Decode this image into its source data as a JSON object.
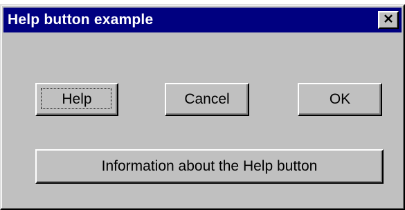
{
  "window": {
    "title": "Help button example",
    "close_icon": "close-x-icon"
  },
  "buttons": {
    "help_label": "Help",
    "cancel_label": "Cancel",
    "ok_label": "OK",
    "info_label": "Information about the Help button"
  },
  "colors": {
    "titlebar": "#000080",
    "face": "#c0c0c0",
    "title_text": "#ffffff"
  }
}
